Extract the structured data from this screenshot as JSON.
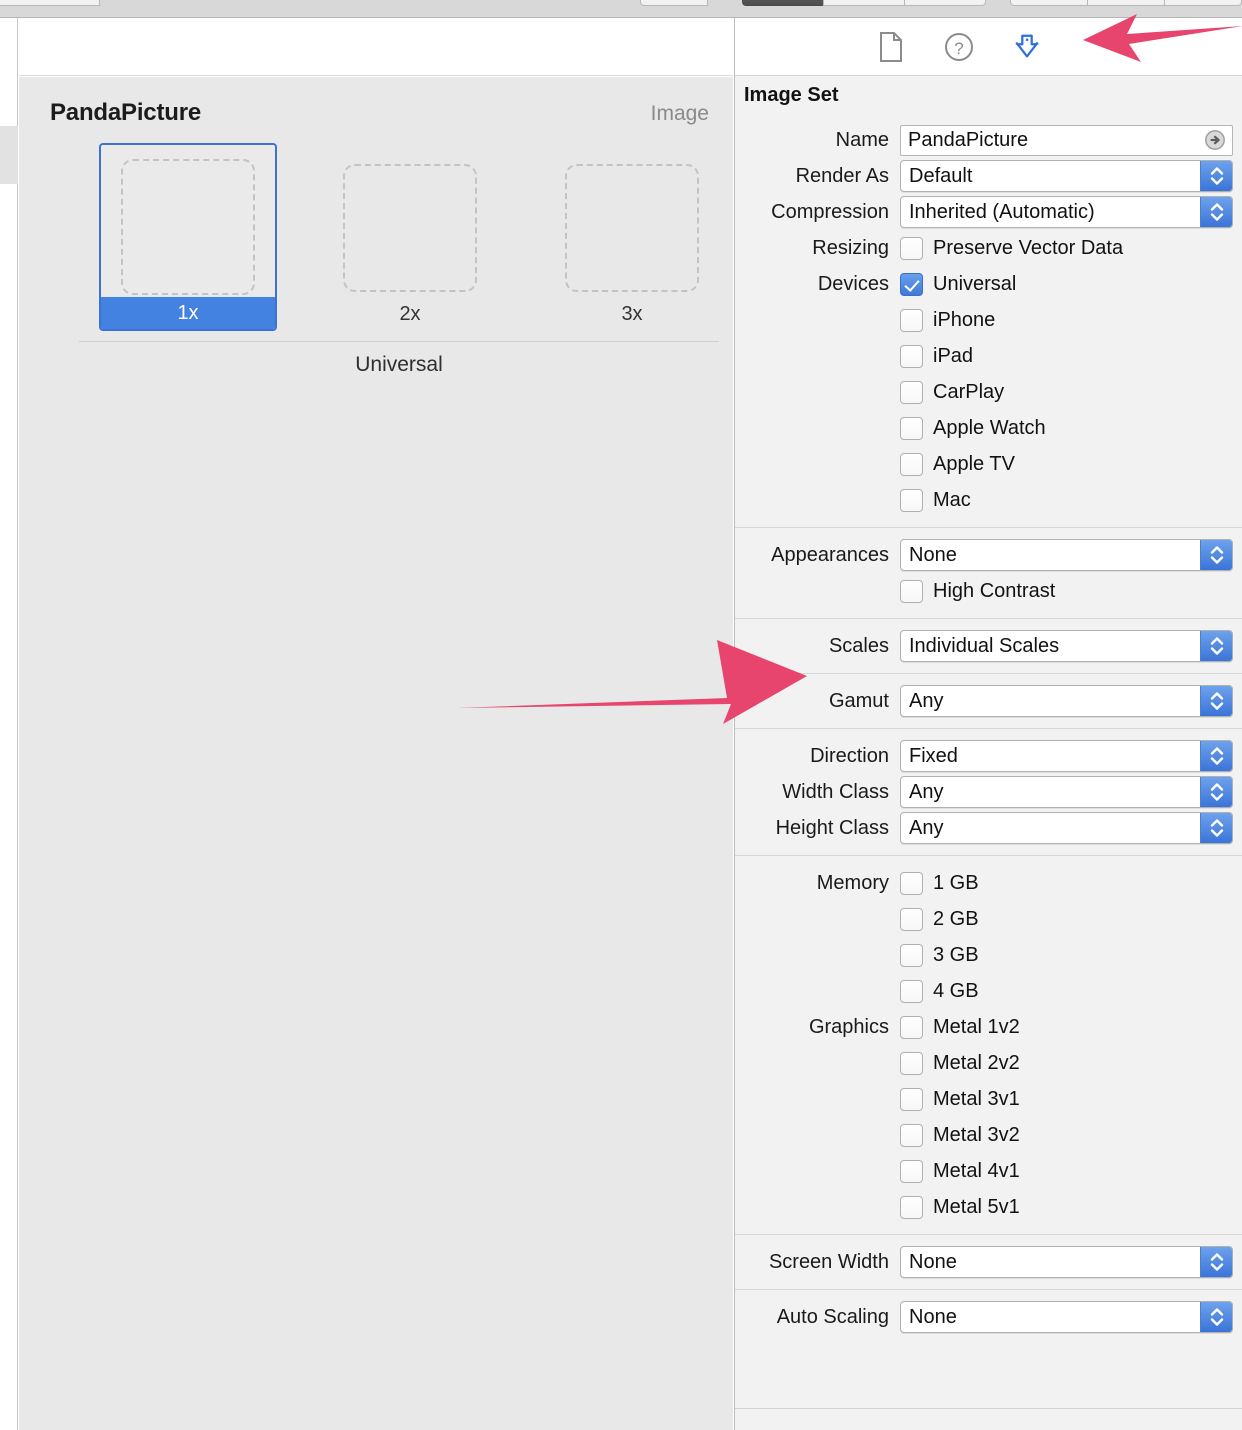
{
  "window": {
    "toolbar_segments": 9
  },
  "editor": {
    "set_title": "PandaPicture",
    "set_kind": "Image",
    "wells": [
      {
        "scale": "1x",
        "selected": true
      },
      {
        "scale": "2x",
        "selected": false
      },
      {
        "scale": "3x",
        "selected": false
      }
    ],
    "group_footer": "Universal"
  },
  "inspector": {
    "toolbar_icons": [
      {
        "name": "file-inspector-icon",
        "glyph": "document"
      },
      {
        "name": "quick-help-icon",
        "glyph": "question-circle"
      },
      {
        "name": "slicing-inspector-icon",
        "glyph": "down-arrow-slice"
      }
    ],
    "heading": "Image Set",
    "name_row": {
      "label": "Name",
      "value": "PandaPicture"
    },
    "render_as": {
      "label": "Render As",
      "value": "Default"
    },
    "compression": {
      "label": "Compression",
      "value": "Inherited (Automatic)"
    },
    "resizing": {
      "label": "Resizing",
      "option": "Preserve Vector Data",
      "checked": false
    },
    "devices": {
      "label": "Devices",
      "options": [
        {
          "label": "Universal",
          "checked": true
        },
        {
          "label": "iPhone",
          "checked": false
        },
        {
          "label": "iPad",
          "checked": false
        },
        {
          "label": "CarPlay",
          "checked": false
        },
        {
          "label": "Apple Watch",
          "checked": false
        },
        {
          "label": "Apple TV",
          "checked": false
        },
        {
          "label": "Mac",
          "checked": false
        }
      ]
    },
    "appearances": {
      "label": "Appearances",
      "value": "None"
    },
    "high_contrast": {
      "label": "",
      "option": "High Contrast",
      "checked": false
    },
    "scales": {
      "label": "Scales",
      "value": "Individual Scales"
    },
    "gamut": {
      "label": "Gamut",
      "value": "Any"
    },
    "direction": {
      "label": "Direction",
      "value": "Fixed"
    },
    "width_class": {
      "label": "Width Class",
      "value": "Any"
    },
    "height_class": {
      "label": "Height Class",
      "value": "Any"
    },
    "memory": {
      "label": "Memory",
      "options": [
        {
          "label": "1 GB",
          "checked": false
        },
        {
          "label": "2 GB",
          "checked": false
        },
        {
          "label": "3 GB",
          "checked": false
        },
        {
          "label": "4 GB",
          "checked": false
        }
      ]
    },
    "graphics": {
      "label": "Graphics",
      "options": [
        {
          "label": "Metal 1v2",
          "checked": false
        },
        {
          "label": "Metal 2v2",
          "checked": false
        },
        {
          "label": "Metal 3v1",
          "checked": false
        },
        {
          "label": "Metal 3v2",
          "checked": false
        },
        {
          "label": "Metal 4v1",
          "checked": false
        },
        {
          "label": "Metal 5v1",
          "checked": false
        }
      ]
    },
    "screen_width": {
      "label": "Screen Width",
      "value": "None"
    },
    "auto_scaling": {
      "label": "Auto Scaling",
      "value": "None"
    }
  },
  "annotations": [
    {
      "name": "arrow-to-slicing-icon",
      "color": "#E8456E",
      "direction": "left"
    },
    {
      "name": "arrow-to-scales-row",
      "color": "#E8456E",
      "direction": "right"
    }
  ],
  "colors": {
    "accent_blue": "#4382e0",
    "annotation_pink": "#E8456E",
    "editor_bg": "#e8e8e8",
    "inspector_bg": "#f2f2f2"
  }
}
